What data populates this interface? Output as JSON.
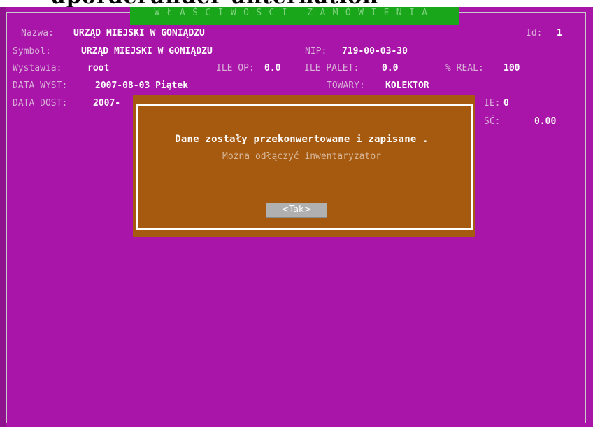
{
  "header_cut_text": "uporderunder unternation",
  "title_bar": "WŁAŚCIWOŚCI ZAMÓWIENIA",
  "fields": {
    "nazwa_label": "Nazwa:",
    "nazwa_value": "URZĄD MIEJSKI W GONIĄDZU",
    "id_label": "Id:",
    "id_value": "1",
    "symbol_label": "Symbol:",
    "symbol_value": "URZĄD MIEJSKI W GONIĄDZU",
    "nip_label": "NIP:",
    "nip_value": "719-00-03-30",
    "wystawia_label": "Wystawia:",
    "wystawia_value": "root",
    "ile_op_label": "ILE OP:",
    "ile_op_value": "0.0",
    "ile_palet_label": "ILE PALET:",
    "ile_palet_value": "0.0",
    "real_label": "% REAL:",
    "real_value": "100",
    "data_wyst_label": "DATA WYST:",
    "data_wyst_value": "2007-08-03 Piątek",
    "towary_label": "TOWARY:",
    "towary_value": "KOLEKTOR",
    "data_dost_label": "DATA DOST:",
    "data_dost_value": "2007-",
    "ie_label": "IE:",
    "ie_value": "0",
    "sc_label": "ŚĆ:",
    "sc_value": "0.00"
  },
  "dialog": {
    "message": "Dane zostały przekonwertowane i zapisane .",
    "submessage": "Można odłączyć inwentaryzator",
    "button": "<Tak>"
  },
  "colors": {
    "background": "#a815a8",
    "title_bar": "#1aa61a",
    "dialog": "#a55a10",
    "button": "#b0b0b0"
  }
}
